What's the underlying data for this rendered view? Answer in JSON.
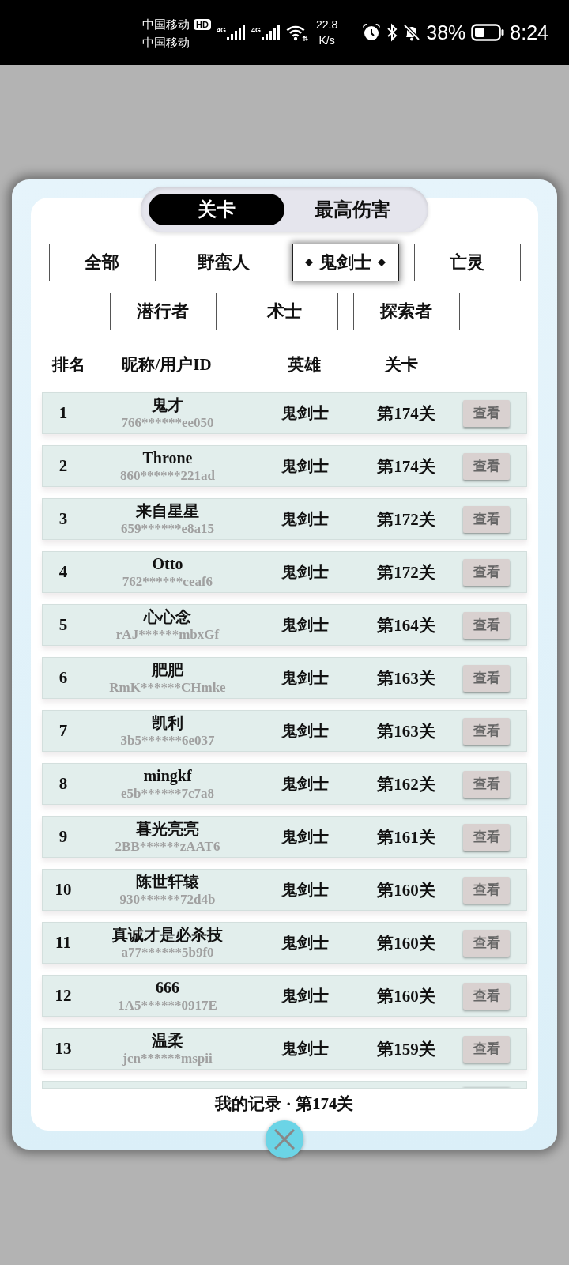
{
  "status_bar": {
    "carriers": [
      "中国移动",
      "中国移动"
    ],
    "hd_badge": "HD",
    "signals": [
      {
        "network": "4G"
      },
      {
        "network": "4G"
      }
    ],
    "net_speed": {
      "value": "22.8",
      "unit": "K/s"
    },
    "battery_percent": "38%",
    "time": "8:24"
  },
  "modal": {
    "mode_tabs": [
      {
        "label": "关卡",
        "selected": true
      },
      {
        "label": "最高伤害",
        "selected": false
      }
    ],
    "hero_filters": [
      {
        "label": "全部",
        "selected": false
      },
      {
        "label": "野蛮人",
        "selected": false
      },
      {
        "label": "鬼剑士",
        "selected": true
      },
      {
        "label": "亡灵",
        "selected": false
      },
      {
        "label": "潜行者",
        "selected": false
      },
      {
        "label": "术士",
        "selected": false
      },
      {
        "label": "探索者",
        "selected": false
      }
    ],
    "table": {
      "columns": [
        "排名",
        "昵称/用户ID",
        "英雄",
        "关卡"
      ],
      "rows": [
        {
          "rank": "1",
          "nickname": "鬼才",
          "user_id": "766******ee050",
          "hero": "鬼剑士",
          "stage": "第174关",
          "action": "查看"
        },
        {
          "rank": "2",
          "nickname": "Throne",
          "user_id": "860******221ad",
          "hero": "鬼剑士",
          "stage": "第174关",
          "action": "查看"
        },
        {
          "rank": "3",
          "nickname": "来自星星",
          "user_id": "659******e8a15",
          "hero": "鬼剑士",
          "stage": "第172关",
          "action": "查看"
        },
        {
          "rank": "4",
          "nickname": "Otto",
          "user_id": "762******ceaf6",
          "hero": "鬼剑士",
          "stage": "第172关",
          "action": "查看"
        },
        {
          "rank": "5",
          "nickname": "心心念",
          "user_id": "rAJ******mbxGf",
          "hero": "鬼剑士",
          "stage": "第164关",
          "action": "查看"
        },
        {
          "rank": "6",
          "nickname": "肥肥",
          "user_id": "RmK******CHmke",
          "hero": "鬼剑士",
          "stage": "第163关",
          "action": "查看"
        },
        {
          "rank": "7",
          "nickname": "凯利",
          "user_id": "3b5******6e037",
          "hero": "鬼剑士",
          "stage": "第163关",
          "action": "查看"
        },
        {
          "rank": "8",
          "nickname": "mingkf",
          "user_id": "e5b******7c7a8",
          "hero": "鬼剑士",
          "stage": "第162关",
          "action": "查看"
        },
        {
          "rank": "9",
          "nickname": "暮光亮亮",
          "user_id": "2BB******zAAT6",
          "hero": "鬼剑士",
          "stage": "第161关",
          "action": "查看"
        },
        {
          "rank": "10",
          "nickname": "陈世轩辕",
          "user_id": "930******72d4b",
          "hero": "鬼剑士",
          "stage": "第160关",
          "action": "查看"
        },
        {
          "rank": "11",
          "nickname": "真诚才是必杀技",
          "user_id": "a77******5b9f0",
          "hero": "鬼剑士",
          "stage": "第160关",
          "action": "查看"
        },
        {
          "rank": "12",
          "nickname": "666",
          "user_id": "1A5******0917E",
          "hero": "鬼剑士",
          "stage": "第160关",
          "action": "查看"
        },
        {
          "rank": "13",
          "nickname": "温柔",
          "user_id": "jcn******mspii",
          "hero": "鬼剑士",
          "stage": "第159关",
          "action": "查看"
        }
      ],
      "more_rows_below": true
    },
    "my_record": "我的记录 · 第174关"
  }
}
